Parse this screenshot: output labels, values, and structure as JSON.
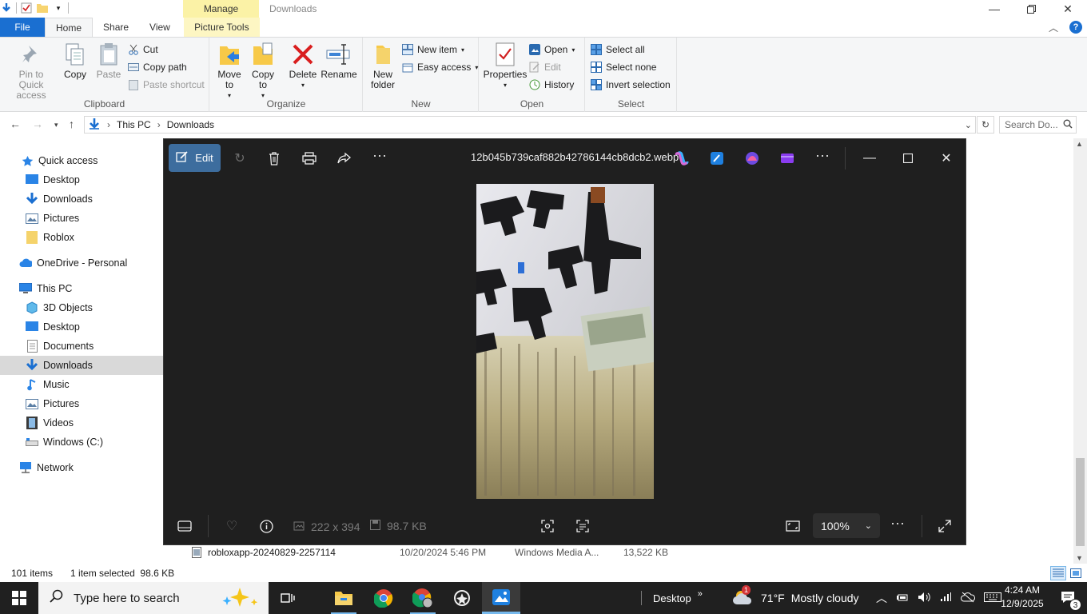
{
  "titlebar": {
    "manage_tab": "Manage",
    "title": "Downloads"
  },
  "ribbon_tabs": {
    "file": "File",
    "home": "Home",
    "share": "Share",
    "view": "View",
    "picture_tools": "Picture Tools"
  },
  "ribbon": {
    "clipboard": {
      "label": "Clipboard",
      "pin": "Pin to Quick access",
      "copy": "Copy",
      "paste": "Paste",
      "cut": "Cut",
      "copy_path": "Copy path",
      "paste_shortcut": "Paste shortcut"
    },
    "organize": {
      "label": "Organize",
      "move_to": "Move to",
      "copy_to": "Copy to",
      "delete": "Delete",
      "rename": "Rename"
    },
    "new": {
      "label": "New",
      "new_folder": "New folder",
      "new_item": "New item",
      "easy_access": "Easy access"
    },
    "open": {
      "label": "Open",
      "properties": "Properties",
      "open": "Open",
      "edit": "Edit",
      "history": "History"
    },
    "select": {
      "label": "Select",
      "select_all": "Select all",
      "select_none": "Select none",
      "invert": "Invert selection"
    }
  },
  "address": {
    "crumb1": "This PC",
    "crumb2": "Downloads",
    "search_placeholder": "Search Do..."
  },
  "navpane": {
    "quick_access": "Quick access",
    "qa_items": [
      "Desktop",
      "Downloads",
      "Pictures",
      "Roblox"
    ],
    "onedrive": "OneDrive - Personal",
    "this_pc": "This PC",
    "pc_items": [
      "3D Objects",
      "Desktop",
      "Documents",
      "Downloads",
      "Music",
      "Pictures",
      "Videos",
      "Windows (C:)"
    ],
    "network": "Network"
  },
  "file_row": {
    "name": "robloxapp-20240829-2257114",
    "date": "10/20/2024 5:46 PM",
    "type": "Windows Media A...",
    "size": "13,522 KB"
  },
  "status": {
    "count": "101 items",
    "selected": "1 item selected  98.6 KB"
  },
  "viewer": {
    "edit": "Edit",
    "filename": "12b045b739caf882b42786144cb8dcb2.webp",
    "dimensions": "222 x 394",
    "filesize": "98.7 KB",
    "zoom": "100%"
  },
  "taskbar": {
    "search_placeholder": "Type here to search",
    "desktop": "Desktop",
    "weather_temp": "71°F",
    "weather_desc": "Mostly cloudy",
    "time": "4:24 AM",
    "date": "12/9/2025",
    "notif_count": "3",
    "weather_badge": "1"
  }
}
